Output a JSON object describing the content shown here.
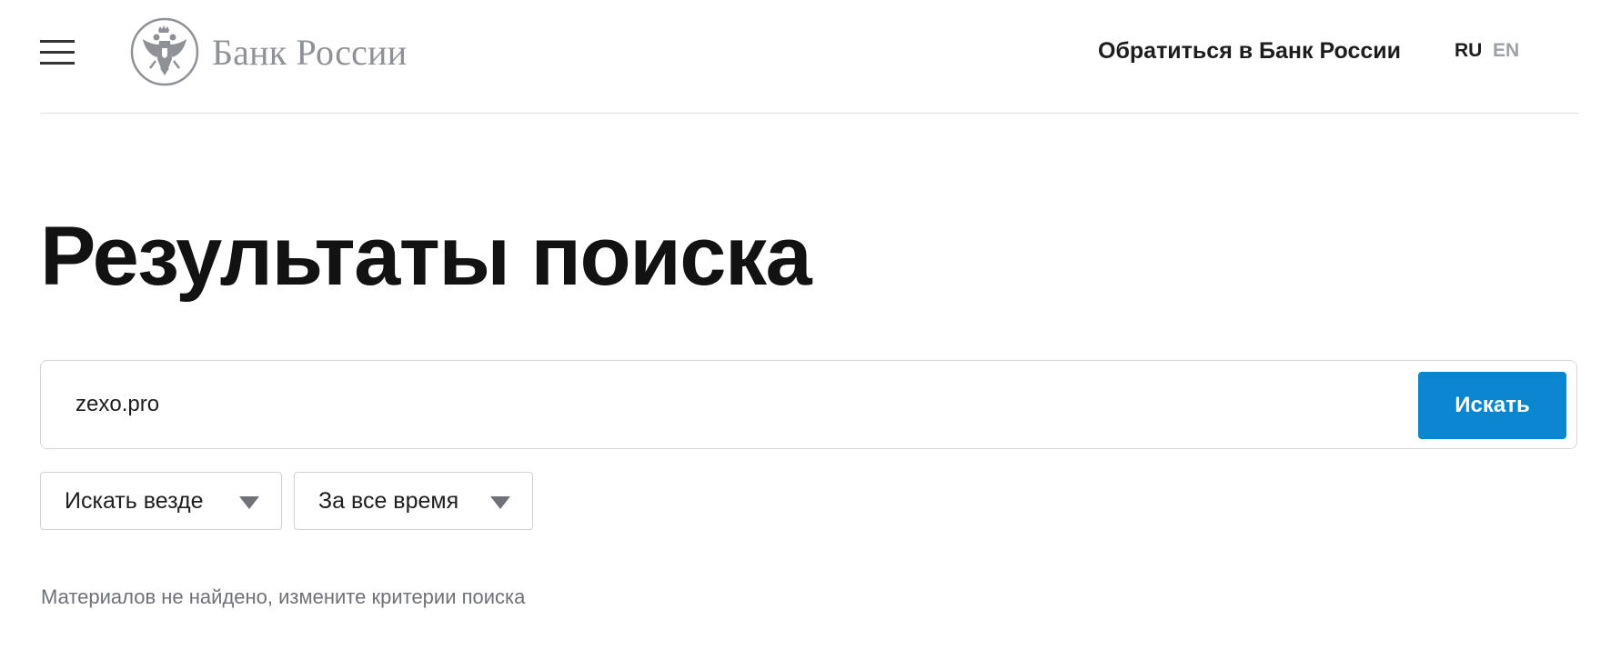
{
  "header": {
    "logo_text": "Банк России",
    "contact_link": "Обратиться в Банк России",
    "lang_ru": "RU",
    "lang_en": "EN"
  },
  "main": {
    "title": "Результаты поиска",
    "search": {
      "value": "zexo.pro",
      "button_label": "Искать"
    },
    "filters": [
      {
        "label": "Искать везде"
      },
      {
        "label": "За все время"
      }
    ],
    "empty_message": "Материалов не найдено, измените критерии поиска"
  },
  "icons": {
    "menu": "hamburger-menu-icon",
    "emblem": "double-headed-eagle-emblem",
    "dropdown": "triangle-down-icon"
  },
  "colors": {
    "accent": "#0a86cf",
    "logo_gray": "#8e9196",
    "muted_text": "#6d7178"
  }
}
